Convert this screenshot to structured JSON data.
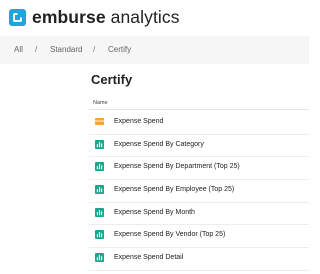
{
  "brand": {
    "name_bold": "emburse",
    "name_rest": " analytics",
    "logo_color": "#1ea5e0"
  },
  "breadcrumb": {
    "items": [
      "All",
      "Standard",
      "Certify"
    ],
    "separator": "/"
  },
  "page": {
    "title": "Certify",
    "column_header": "Name"
  },
  "items": [
    {
      "label": "Expense Spend",
      "icon": "dashboard-icon"
    },
    {
      "label": "Expense Spend By Category",
      "icon": "bar-chart-icon"
    },
    {
      "label": "Expense Spend By Department (Top 25)",
      "icon": "bar-chart-icon"
    },
    {
      "label": "Expense Spend By Employee (Top 25)",
      "icon": "bar-chart-icon"
    },
    {
      "label": "Expense Spend By Month",
      "icon": "bar-chart-icon"
    },
    {
      "label": "Expense Spend By Vendor (Top 25)",
      "icon": "bar-chart-icon"
    },
    {
      "label": "Expense Spend Detail",
      "icon": "bar-chart-icon"
    }
  ],
  "colors": {
    "report_icon": "#1aa68c",
    "dashboard_icon": "#f2a535"
  }
}
